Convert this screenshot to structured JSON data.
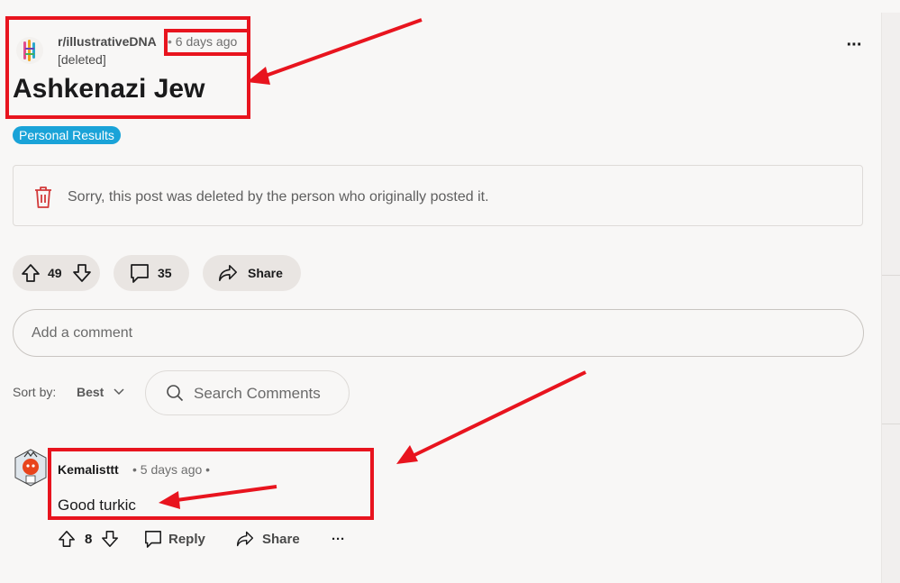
{
  "post": {
    "subreddit": "r/illustrativeDNA",
    "dot": "•",
    "time": "6 days ago",
    "author": "[deleted]",
    "title": "Ashkenazi Jew",
    "flair": "Personal Results",
    "flair_color": "#1aa3d8",
    "deleted_notice": "Sorry, this post was deleted by the person who originally posted it.",
    "votes": "49",
    "comments": "35",
    "share_label": "Share"
  },
  "comment_input": {
    "placeholder": "Add a comment"
  },
  "sort": {
    "label": "Sort by:",
    "value": "Best"
  },
  "search": {
    "placeholder": "Search Comments"
  },
  "comment": {
    "username": "Kemalisttt",
    "time": "• 5 days ago •",
    "body": "Good turkic",
    "votes": "8",
    "reply_label": "Reply",
    "share_label": "Share",
    "more_label": "···"
  },
  "annotation_color": "#e8141e",
  "icons": [
    "subreddit-avatar-icon",
    "more-options-icon",
    "trash-icon",
    "upvote-icon",
    "downvote-icon",
    "comment-icon",
    "share-icon",
    "chevron-down-icon",
    "search-icon",
    "user-avatar-icon"
  ]
}
